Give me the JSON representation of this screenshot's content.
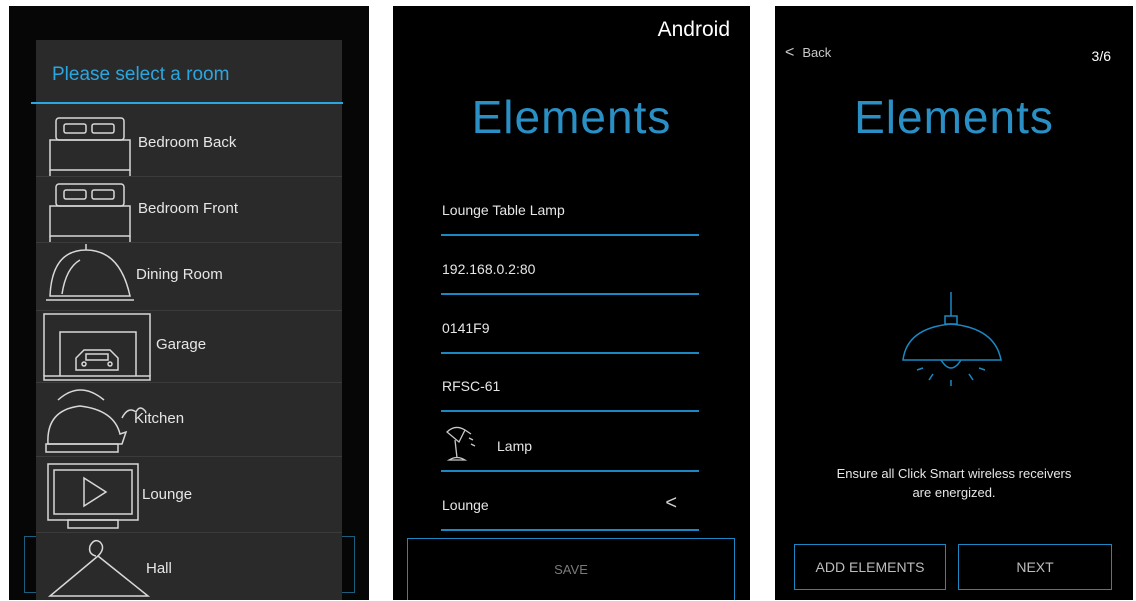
{
  "screen_room_select": {
    "dialog_title": "Please select a room",
    "rooms": [
      {
        "label": "Bedroom Back",
        "icon": "bed-icon"
      },
      {
        "label": "Bedroom Front",
        "icon": "bed-icon"
      },
      {
        "label": "Dining Room",
        "icon": "cloche-icon"
      },
      {
        "label": "Garage",
        "icon": "garage-icon"
      },
      {
        "label": "Kitchen",
        "icon": "kettle-icon"
      },
      {
        "label": "Lounge",
        "icon": "tv-icon"
      },
      {
        "label": "Hall",
        "icon": "hanger-icon"
      }
    ]
  },
  "screen_edit_element": {
    "platform_label": "Android",
    "title": "Elements",
    "fields": {
      "name": "Lounge Table Lamp",
      "address": "192.168.0.2:80",
      "id": "0141F9",
      "model": "RFSC-61",
      "type": "Lamp",
      "room": "Lounge"
    },
    "save_label": "SAVE"
  },
  "screen_setup_step": {
    "back_label": "Back",
    "step_indicator": "3/6",
    "title": "Elements",
    "info_line1": "Ensure all Click Smart wireless receivers",
    "info_line2": "are energized.",
    "add_label": "ADD ELEMENTS",
    "next_label": "NEXT"
  },
  "colors": {
    "accent": "#2a8fc4",
    "dialog_title": "#2aa6e0",
    "background": "#000000",
    "dialog_background": "#2a2a2a"
  }
}
